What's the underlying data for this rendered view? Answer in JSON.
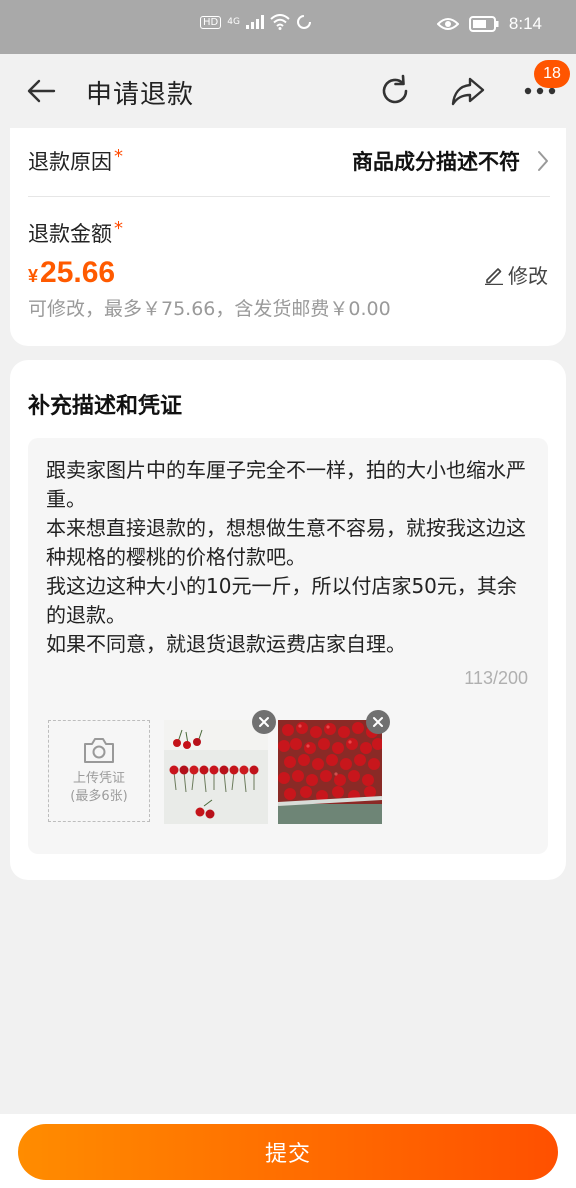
{
  "status": {
    "time": "8:14",
    "network": "4G",
    "hd": "HD"
  },
  "nav": {
    "title": "申请退款",
    "badge_count": "18"
  },
  "refund": {
    "reason_label": "退款原因",
    "reason_value": "商品成分描述不符",
    "amount_label": "退款金额",
    "required_mark": "*",
    "currency": "¥",
    "amount": "25.66",
    "edit_label": "修改",
    "note": "可修改，最多￥75.66，含发货邮费￥0.00"
  },
  "evidence": {
    "title": "补充描述和凭证",
    "description": "跟卖家图片中的车厘子完全不一样，拍的大小也缩水严重。\n本来想直接退款的，想想做生意不容易，就按我这边这种规格的樱桃的价格付款吧。\n我这边这种大小的10元一斤，所以付店家50元，其余的退款。\n如果不同意，就退货退款运费店家自理。",
    "char_count": "113/200",
    "upload_line1": "上传凭证",
    "upload_line2": "(最多6张)"
  },
  "submit_label": "提交",
  "colors": {
    "accent": "#ff5500",
    "button_start": "#ff8c00",
    "button_end": "#ff5000"
  }
}
